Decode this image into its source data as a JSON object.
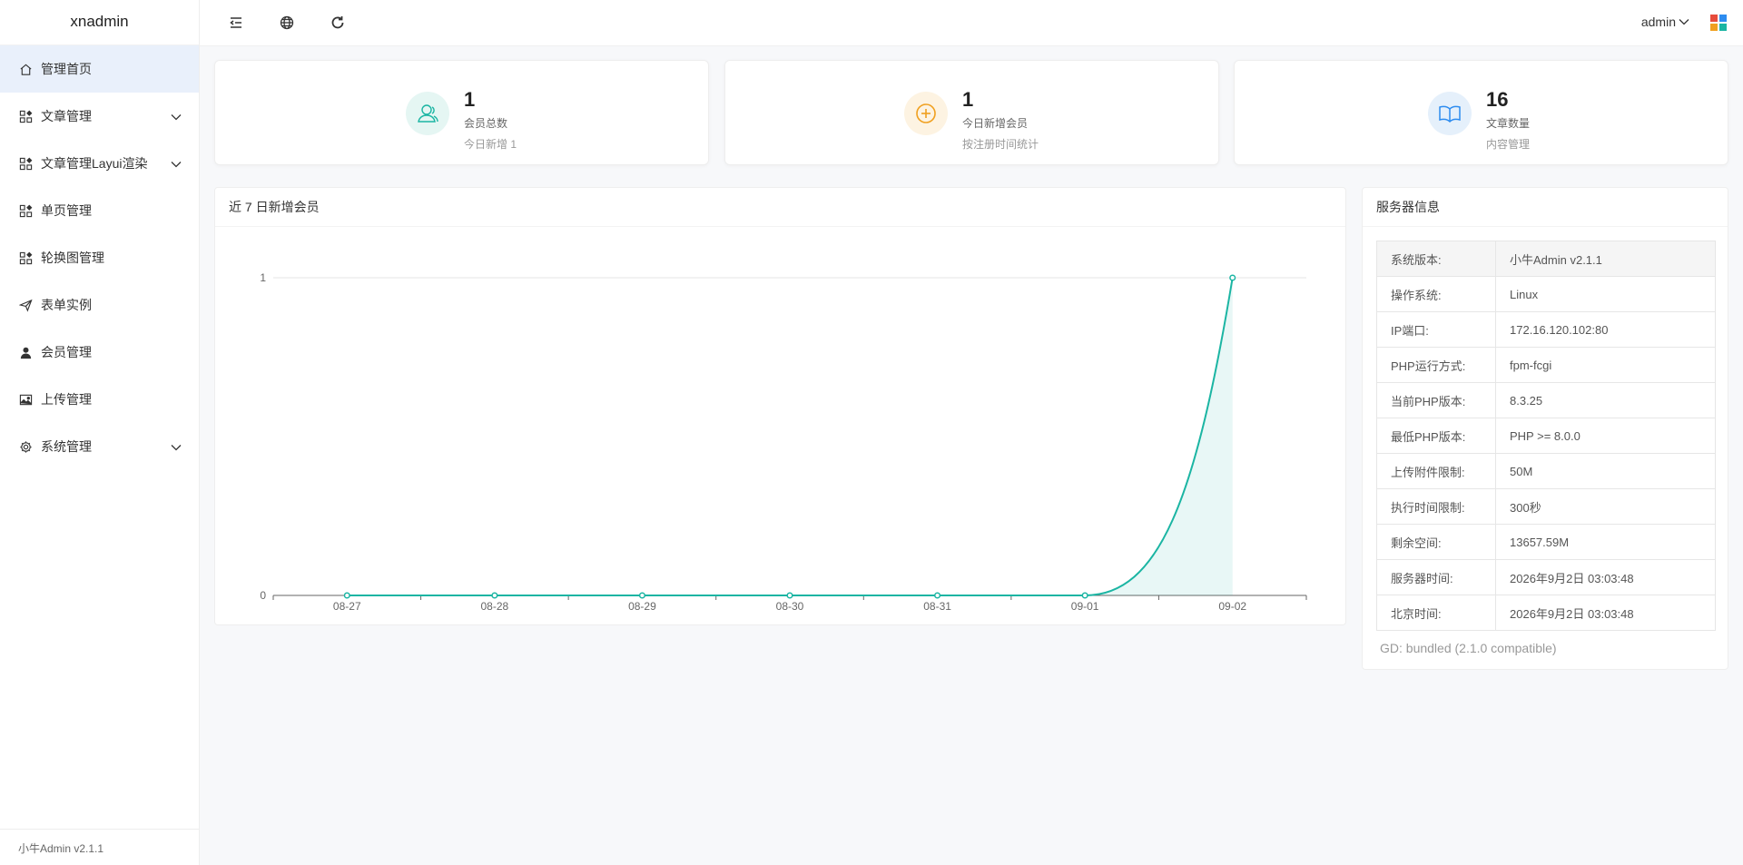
{
  "app": {
    "logo": "xnadmin",
    "footer": "小牛Admin v2.1.1"
  },
  "sidebar": {
    "items": [
      {
        "label": "管理首页",
        "icon": "home-icon",
        "active": true,
        "expandable": false
      },
      {
        "label": "文章管理",
        "icon": "grid-icon",
        "active": false,
        "expandable": true
      },
      {
        "label": "文章管理Layui渲染",
        "icon": "grid-icon",
        "active": false,
        "expandable": true
      },
      {
        "label": "单页管理",
        "icon": "grid-icon",
        "active": false,
        "expandable": false
      },
      {
        "label": "轮换图管理",
        "icon": "grid-icon",
        "active": false,
        "expandable": false
      },
      {
        "label": "表单实例",
        "icon": "send-icon",
        "active": false,
        "expandable": false
      },
      {
        "label": "会员管理",
        "icon": "user-icon",
        "active": false,
        "expandable": false
      },
      {
        "label": "上传管理",
        "icon": "image-icon",
        "active": false,
        "expandable": false
      },
      {
        "label": "系统管理",
        "icon": "gear-icon",
        "active": false,
        "expandable": true
      }
    ]
  },
  "header": {
    "username": "admin",
    "icons": [
      "menu-collapse-icon",
      "globe-icon",
      "refresh-icon",
      "theme-icon"
    ]
  },
  "stats": [
    {
      "value": "1",
      "label": "会员总数",
      "sub": "今日新增 1",
      "icon": "users-icon",
      "color": "#1bb5a3",
      "bg": "#e5f6f3"
    },
    {
      "value": "1",
      "label": "今日新增会员",
      "sub": "按注册时间统计",
      "icon": "plus-circle-icon",
      "color": "#f0a020",
      "bg": "#fdf3e2"
    },
    {
      "value": "16",
      "label": "文章数量",
      "sub": "内容管理",
      "icon": "book-icon",
      "color": "#2d8cf0",
      "bg": "#e5f0fb"
    }
  ],
  "chart": {
    "title": "近 7 日新增会员",
    "color": "#1bb5a3"
  },
  "chart_data": {
    "type": "area",
    "categories": [
      "08-27",
      "08-28",
      "08-29",
      "08-30",
      "08-31",
      "09-01",
      "09-02"
    ],
    "values": [
      0,
      0,
      0,
      0,
      0,
      0,
      1
    ],
    "title": "近 7 日新增会员",
    "xlabel": "",
    "ylabel": "",
    "ylim": [
      0,
      1
    ],
    "yticks": [
      0,
      1
    ],
    "grid": true,
    "smooth": true
  },
  "server": {
    "title": "服务器信息",
    "rows": [
      {
        "k": "系统版本:",
        "v": "小牛Admin v2.1.1"
      },
      {
        "k": "操作系统:",
        "v": "Linux"
      },
      {
        "k": "IP端口:",
        "v": "172.16.120.102:80"
      },
      {
        "k": "PHP运行方式:",
        "v": "fpm-fcgi"
      },
      {
        "k": "当前PHP版本:",
        "v": "8.3.25"
      },
      {
        "k": "最低PHP版本:",
        "v": "PHP >= 8.0.0"
      },
      {
        "k": "上传附件限制:",
        "v": "50M"
      },
      {
        "k": "执行时间限制:",
        "v": "300秒"
      },
      {
        "k": "剩余空间:",
        "v": "13657.59M"
      },
      {
        "k": "服务器时间:",
        "v": "2026年9月2日 03:03:48"
      },
      {
        "k": "北京时间:",
        "v": "2026年9月2日 03:03:48"
      }
    ],
    "footer": "GD: bundled (2.1.0 compatible)"
  }
}
